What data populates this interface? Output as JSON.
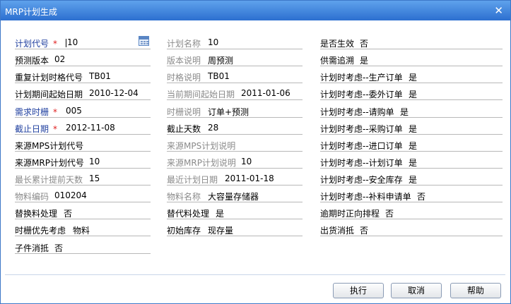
{
  "window": {
    "title": "MRP计划生成"
  },
  "fields": [
    {
      "id": "plan-code",
      "label": "计划代号",
      "value": "10",
      "required": true,
      "style": "blue",
      "cal": true,
      "caret": true
    },
    {
      "id": "plan-name",
      "label": "计划名称",
      "value": "10",
      "style": "gray"
    },
    {
      "id": "is-effective",
      "label": "是否生效",
      "value": "否",
      "style": "normal"
    },
    {
      "id": "forecast-version",
      "label": "预测版本",
      "value": "02",
      "style": "normal"
    },
    {
      "id": "version-desc",
      "label": "版本说明",
      "value": "周预测",
      "style": "gray"
    },
    {
      "id": "demand-trace",
      "label": "供需追溯",
      "value": "是",
      "style": "normal"
    },
    {
      "id": "repeat-plan-fmt",
      "label": "重复计划时格代号",
      "value": "TB01",
      "style": "normal"
    },
    {
      "id": "time-fmt-desc",
      "label": "时格说明",
      "value": "TB01",
      "style": "gray"
    },
    {
      "id": "consider-prod-order",
      "label": "计划时考虑--生产订单",
      "value": "是",
      "style": "normal"
    },
    {
      "id": "plan-start-date",
      "label": "计划期间起始日期",
      "value": "2010-12-04",
      "style": "normal"
    },
    {
      "id": "cur-start-date",
      "label": "当前期间起始日期",
      "value": "2011-01-06",
      "style": "gray"
    },
    {
      "id": "consider-outsource",
      "label": "计划时考虑--委外订单",
      "value": "是",
      "style": "normal"
    },
    {
      "id": "demand-timefence",
      "label": "需求时栅",
      "value": "005",
      "required": true,
      "style": "blue"
    },
    {
      "id": "timefence-desc",
      "label": "时栅说明",
      "value": "订单+预测",
      "style": "gray"
    },
    {
      "id": "consider-requisition",
      "label": "计划时考虑--请购单",
      "value": "是",
      "style": "normal"
    },
    {
      "id": "cutoff-date",
      "label": "截止日期",
      "value": "2012-11-08",
      "required": true,
      "style": "blue"
    },
    {
      "id": "cutoff-days",
      "label": "截止天数",
      "value": "28",
      "style": "normal"
    },
    {
      "id": "consider-purchase",
      "label": "计划时考虑--采购订单",
      "value": "是",
      "style": "normal"
    },
    {
      "id": "src-mps-code",
      "label": "来源MPS计划代号",
      "value": "",
      "style": "normal"
    },
    {
      "id": "src-mps-desc",
      "label": "来源MPS计划说明",
      "value": "",
      "style": "gray"
    },
    {
      "id": "consider-import",
      "label": "计划时考虑--进口订单",
      "value": "是",
      "style": "normal"
    },
    {
      "id": "src-mrp-code",
      "label": "来源MRP计划代号",
      "value": "10",
      "style": "normal"
    },
    {
      "id": "src-mrp-desc",
      "label": "来源MRP计划说明",
      "value": "10",
      "style": "gray"
    },
    {
      "id": "consider-plan-order",
      "label": "计划时考虑--计划订单",
      "value": "是",
      "style": "normal"
    },
    {
      "id": "max-lead-days",
      "label": "最长累计提前天数",
      "value": "15",
      "style": "gray"
    },
    {
      "id": "last-plan-date",
      "label": "最近计划日期",
      "value": "2011-01-18",
      "style": "gray"
    },
    {
      "id": "consider-safety-stock",
      "label": "计划时考虑--安全库存",
      "value": "是",
      "style": "normal"
    },
    {
      "id": "material-code",
      "label": "物料编码",
      "value": "010204",
      "style": "gray"
    },
    {
      "id": "material-name",
      "label": "物料名称",
      "value": "大容量存储器",
      "style": "gray"
    },
    {
      "id": "consider-replenish",
      "label": "计划时考虑--补料申请单",
      "value": "否",
      "style": "normal"
    },
    {
      "id": "substitute-material",
      "label": "替换料处理",
      "value": "否",
      "style": "normal"
    },
    {
      "id": "alternative-material",
      "label": "替代料处理",
      "value": "是",
      "style": "normal"
    },
    {
      "id": "overdue-forward",
      "label": "逾期时正向排程",
      "value": "否",
      "style": "normal"
    },
    {
      "id": "timefence-priority",
      "label": "时栅优先考虑",
      "value": "物料",
      "style": "normal"
    },
    {
      "id": "initial-stock",
      "label": "初始库存",
      "value": "现存量",
      "style": "normal"
    },
    {
      "id": "shipment-offset",
      "label": "出货消抵",
      "value": "否",
      "style": "normal"
    },
    {
      "id": "component-offset",
      "label": "子件消抵",
      "value": "否",
      "style": "normal"
    }
  ],
  "buttons": {
    "execute": "执行",
    "cancel": "取消",
    "help": "帮助"
  }
}
